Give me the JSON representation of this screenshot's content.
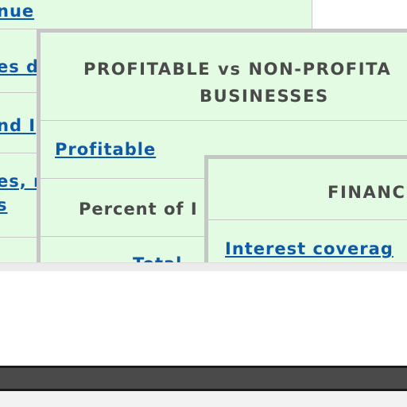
{
  "back_panel": {
    "links": [
      {
        "text": "nue"
      },
      {
        "text": "es d"
      },
      {
        "text": "nd I"
      },
      {
        "text": "es, r"
      },
      {
        "text": "s"
      }
    ]
  },
  "mid_panel": {
    "title_line1": "PROFITABLE vs NON-PROFITA",
    "title_line2": "BUSINESSES",
    "profitable_link": "Profitable",
    "percent_label": "Percent of I",
    "total_label": "Total"
  },
  "front_panel": {
    "title": "FINANC",
    "interest_link": "Interest coverag"
  }
}
